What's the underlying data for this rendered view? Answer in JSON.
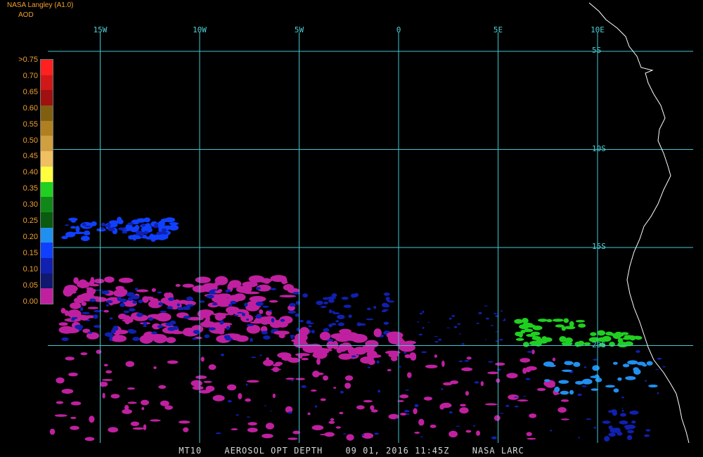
{
  "header": {
    "title": "NASA Langley (A1.0)",
    "units": "AOD"
  },
  "grid": {
    "longitudes": [
      {
        "label": "15W",
        "lon": -15
      },
      {
        "label": "10W",
        "lon": -10
      },
      {
        "label": "5W",
        "lon": -5
      },
      {
        "label": "0",
        "lon": 0
      },
      {
        "label": "5E",
        "lon": 5
      },
      {
        "label": "10E",
        "lon": 10
      }
    ],
    "latitudes": [
      {
        "label": "5S",
        "lat": -5
      },
      {
        "label": "10S",
        "lat": -10
      },
      {
        "label": "15S",
        "lat": -15
      },
      {
        "label": "20S",
        "lat": -20
      }
    ],
    "color": "#40c8d0"
  },
  "legend": {
    "labels": [
      ">0.75",
      "0.70",
      "0.65",
      "0.60",
      "0.55",
      "0.50",
      "0.45",
      "0.40",
      "0.35",
      "0.30",
      "0.25",
      "0.20",
      "0.15",
      "0.10",
      "0.05",
      "0.00"
    ],
    "colors": [
      "#ff2020",
      "#d01818",
      "#a01010",
      "#806010",
      "#b08020",
      "#d0a040",
      "#f0c060",
      "#ffff40",
      "#20d020",
      "#108818",
      "#0a5a10",
      "#2090f0",
      "#1040ff",
      "#1020b0",
      "#101870",
      "#c020a0"
    ]
  },
  "colors": {
    "coastline": "#ffffff",
    "aod_0_00": "#c020a0",
    "aod_0_10": "#1020b0",
    "aod_0_15": "#1040ff",
    "aod_0_20": "#2090f0",
    "aod_0_35": "#20d020"
  },
  "footer": {
    "product": "MT10",
    "variable": "AEROSOL OPT DEPTH",
    "datetime": "09 01, 2016 11:45Z",
    "source": "NASA LARC"
  }
}
